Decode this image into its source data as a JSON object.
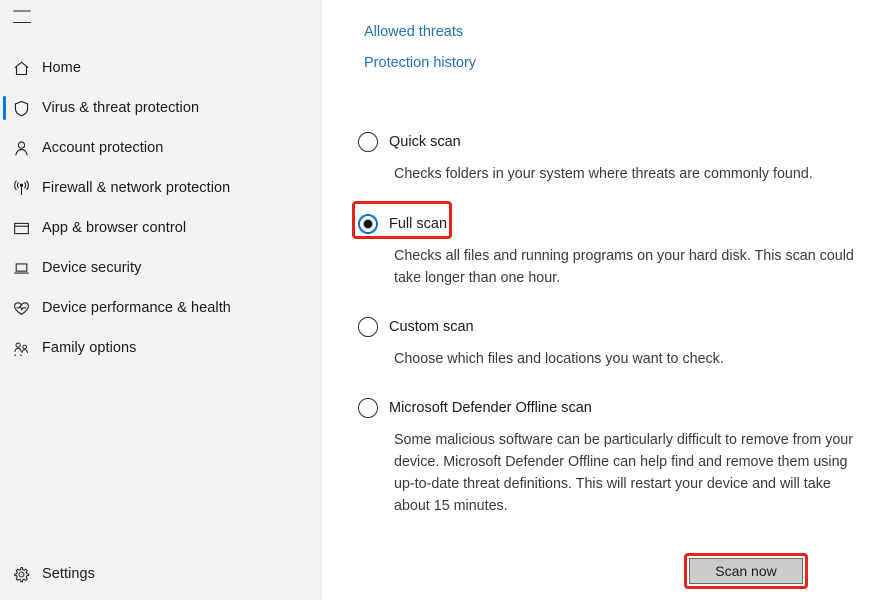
{
  "sidebar": {
    "menu_icon": "hamburger-icon",
    "items": [
      {
        "label": "Home",
        "icon": "home-icon",
        "selected": false
      },
      {
        "label": "Virus & threat protection",
        "icon": "shield-icon",
        "selected": true
      },
      {
        "label": "Account protection",
        "icon": "person-icon",
        "selected": false
      },
      {
        "label": "Firewall & network protection",
        "icon": "wifi-signal-icon",
        "selected": false
      },
      {
        "label": "App & browser control",
        "icon": "app-window-icon",
        "selected": false
      },
      {
        "label": "Device security",
        "icon": "laptop-icon",
        "selected": false
      },
      {
        "label": "Device performance & health",
        "icon": "heart-pulse-icon",
        "selected": false
      },
      {
        "label": "Family options",
        "icon": "family-people-icon",
        "selected": false
      }
    ],
    "settings": {
      "label": "Settings",
      "icon": "gear-icon"
    }
  },
  "main": {
    "links": [
      {
        "label": "Allowed threats"
      },
      {
        "label": "Protection history"
      }
    ],
    "scan_options": [
      {
        "title": "Quick scan",
        "description": "Checks folders in your system where threats are commonly found.",
        "selected": false,
        "highlighted": false
      },
      {
        "title": "Full scan",
        "description": "Checks all files and running programs on your hard disk. This scan could take longer than one hour.",
        "selected": true,
        "highlighted": true
      },
      {
        "title": "Custom scan",
        "description": "Choose which files and locations you want to check.",
        "selected": false,
        "highlighted": false
      },
      {
        "title": "Microsoft Defender Offline scan",
        "description": "Some malicious software can be particularly difficult to remove from your device. Microsoft Defender Offline can help find and remove them using up-to-date threat definitions. This will restart your device and will take about 15 minutes.",
        "selected": false,
        "highlighted": false
      }
    ],
    "scan_now_button": {
      "label": "Scan now",
      "highlighted": true
    }
  },
  "colors": {
    "accent_blue": "#0078d4",
    "link_blue": "#2073b8",
    "highlight_red": "#e8251c",
    "sidebar_bg": "#f2f2f2",
    "content_bg": "#ffffff",
    "button_face": "#cccccc"
  }
}
